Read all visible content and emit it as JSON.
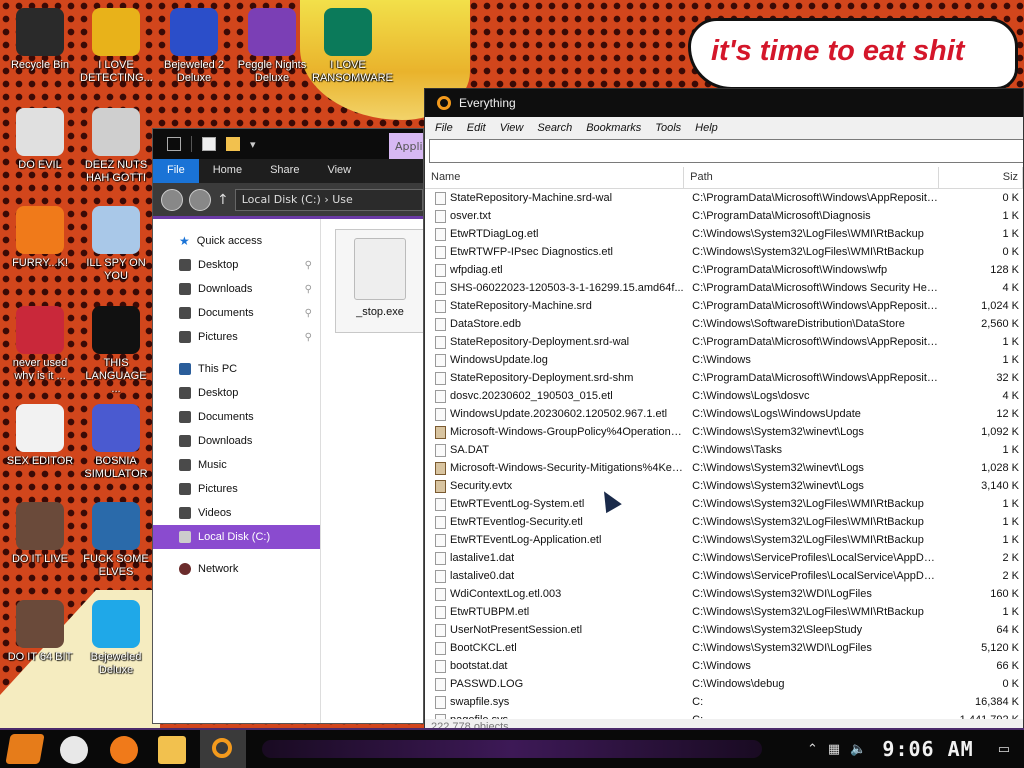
{
  "wallpaper": {
    "speech_text": "it's time to eat shit"
  },
  "desktop": {
    "icons": [
      {
        "label": "Recycle Bin",
        "icon": "recycle-bin-icon",
        "color": "#2a2a2a"
      },
      {
        "label": "I LOVE DETECTING...",
        "icon": "detect-it-easy-icon",
        "color": "#e8b21a"
      },
      {
        "label": "Bejeweled 2 Deluxe",
        "icon": "bejeweled-2-icon",
        "color": "#2b4ec9"
      },
      {
        "label": "Peggle Nights Deluxe",
        "icon": "peggle-nights-icon",
        "color": "#7b3fb5"
      },
      {
        "label": "I LOVE RANSOMWARE",
        "icon": "publisher-icon",
        "color": "#0b7a5a"
      },
      {
        "label": "DO EVIL",
        "icon": "chrome-icon",
        "color": "#e0e0e0"
      },
      {
        "label": "DEEZ NUTS HAH GOTTI",
        "icon": "stacked-windows-icon",
        "color": "#cfcfcf"
      },
      {
        "label": "FURRY...K!",
        "icon": "firefox-icon",
        "color": "#f07a1a"
      },
      {
        "label": "ILL SPY ON YOU",
        "icon": "spy-camera-icon",
        "color": "#a9c8e8"
      },
      {
        "label": "never used why is it ...",
        "icon": "character-app-icon",
        "color": "#c9283a"
      },
      {
        "label": "THIS LANGUAGE ...",
        "icon": "goland-icon",
        "color": "#111111"
      },
      {
        "label": "SEX EDITOR",
        "icon": "hxd-icon",
        "color": "#f2f2f2"
      },
      {
        "label": "BOSNIA SIMULATOR",
        "icon": "mine-icon",
        "color": "#4a5ad0"
      },
      {
        "label": "DO IT LIVE",
        "icon": "portrait-icon",
        "color": "#6a4a3a"
      },
      {
        "label": "FUCK SOME ELVES",
        "icon": "santa-icon",
        "color": "#2a6aaa"
      },
      {
        "label": "DO IT 64 BIT",
        "icon": "portrait-64-icon",
        "color": "#6a4a3a"
      },
      {
        "label": "Bejeweled Deluxe",
        "icon": "diamond-icon",
        "color": "#1fa8e8"
      }
    ]
  },
  "explorer": {
    "app_tab": "Appli",
    "ribbon_tabs": [
      "File",
      "Home",
      "Share",
      "View"
    ],
    "address": "Local Disk (C:)  ›  Use",
    "nav": {
      "quick_access": "Quick access",
      "quick_items": [
        "Desktop",
        "Downloads",
        "Documents",
        "Pictures"
      ],
      "this_pc": "This PC",
      "pc_items": [
        "Desktop",
        "Documents",
        "Downloads",
        "Music",
        "Pictures",
        "Videos"
      ],
      "selected": "Local Disk (C:)",
      "network": "Network"
    },
    "file_name": "_stop.exe"
  },
  "everything": {
    "title": "Everything",
    "menu": [
      "File",
      "Edit",
      "View",
      "Search",
      "Bookmarks",
      "Tools",
      "Help"
    ],
    "search_value": "",
    "columns": {
      "name": "Name",
      "path": "Path",
      "size": "Siz"
    },
    "rows": [
      {
        "name": "StateRepository-Machine.srd-wal",
        "path": "C:\\ProgramData\\Microsoft\\Windows\\AppRepository",
        "size": "0 K",
        "icon": "file"
      },
      {
        "name": "osver.txt",
        "path": "C:\\ProgramData\\Microsoft\\Diagnosis",
        "size": "1 K",
        "icon": "file"
      },
      {
        "name": "EtwRTDiagLog.etl",
        "path": "C:\\Windows\\System32\\LogFiles\\WMI\\RtBackup",
        "size": "1 K",
        "icon": "file"
      },
      {
        "name": "EtwRTWFP-IPsec Diagnostics.etl",
        "path": "C:\\Windows\\System32\\LogFiles\\WMI\\RtBackup",
        "size": "0 K",
        "icon": "file"
      },
      {
        "name": "wfpdiag.etl",
        "path": "C:\\ProgramData\\Microsoft\\Windows\\wfp",
        "size": "128 K",
        "icon": "file"
      },
      {
        "name": "SHS-06022023-120503-3-1-16299.15.amd64f...",
        "path": "C:\\ProgramData\\Microsoft\\Windows Security Heal...",
        "size": "4 K",
        "icon": "file"
      },
      {
        "name": "StateRepository-Machine.srd",
        "path": "C:\\ProgramData\\Microsoft\\Windows\\AppRepository",
        "size": "1,024 K",
        "icon": "file"
      },
      {
        "name": "DataStore.edb",
        "path": "C:\\Windows\\SoftwareDistribution\\DataStore",
        "size": "2,560 K",
        "icon": "file"
      },
      {
        "name": "StateRepository-Deployment.srd-wal",
        "path": "C:\\ProgramData\\Microsoft\\Windows\\AppRepository",
        "size": "1 K",
        "icon": "file"
      },
      {
        "name": "WindowsUpdate.log",
        "path": "C:\\Windows",
        "size": "1 K",
        "icon": "file"
      },
      {
        "name": "StateRepository-Deployment.srd-shm",
        "path": "C:\\ProgramData\\Microsoft\\Windows\\AppRepository",
        "size": "32 K",
        "icon": "file"
      },
      {
        "name": "dosvc.20230602_190503_015.etl",
        "path": "C:\\Windows\\Logs\\dosvc",
        "size": "4 K",
        "icon": "file"
      },
      {
        "name": "WindowsUpdate.20230602.120502.967.1.etl",
        "path": "C:\\Windows\\Logs\\WindowsUpdate",
        "size": "12 K",
        "icon": "file"
      },
      {
        "name": "Microsoft-Windows-GroupPolicy%4Operational...",
        "path": "C:\\Windows\\System32\\winevt\\Logs",
        "size": "1,092 K",
        "icon": "evt"
      },
      {
        "name": "SA.DAT",
        "path": "C:\\Windows\\Tasks",
        "size": "1 K",
        "icon": "file"
      },
      {
        "name": "Microsoft-Windows-Security-Mitigations%4Kern...",
        "path": "C:\\Windows\\System32\\winevt\\Logs",
        "size": "1,028 K",
        "icon": "evt"
      },
      {
        "name": "Security.evtx",
        "path": "C:\\Windows\\System32\\winevt\\Logs",
        "size": "3,140 K",
        "icon": "evt"
      },
      {
        "name": "EtwRTEventLog-System.etl",
        "path": "C:\\Windows\\System32\\LogFiles\\WMI\\RtBackup",
        "size": "1 K",
        "icon": "file"
      },
      {
        "name": "EtwRTEventlog-Security.etl",
        "path": "C:\\Windows\\System32\\LogFiles\\WMI\\RtBackup",
        "size": "1 K",
        "icon": "file"
      },
      {
        "name": "EtwRTEventLog-Application.etl",
        "path": "C:\\Windows\\System32\\LogFiles\\WMI\\RtBackup",
        "size": "1 K",
        "icon": "file"
      },
      {
        "name": "lastalive1.dat",
        "path": "C:\\Windows\\ServiceProfiles\\LocalService\\AppDat...",
        "size": "2 K",
        "icon": "file"
      },
      {
        "name": "lastalive0.dat",
        "path": "C:\\Windows\\ServiceProfiles\\LocalService\\AppDat...",
        "size": "2 K",
        "icon": "file"
      },
      {
        "name": "WdiContextLog.etl.003",
        "path": "C:\\Windows\\System32\\WDI\\LogFiles",
        "size": "160 K",
        "icon": "file"
      },
      {
        "name": "EtwRTUBPM.etl",
        "path": "C:\\Windows\\System32\\LogFiles\\WMI\\RtBackup",
        "size": "1 K",
        "icon": "file"
      },
      {
        "name": "UserNotPresentSession.etl",
        "path": "C:\\Windows\\System32\\SleepStudy",
        "size": "64 K",
        "icon": "file"
      },
      {
        "name": "BootCKCL.etl",
        "path": "C:\\Windows\\System32\\WDI\\LogFiles",
        "size": "5,120 K",
        "icon": "file"
      },
      {
        "name": "bootstat.dat",
        "path": "C:\\Windows",
        "size": "66 K",
        "icon": "file"
      },
      {
        "name": "PASSWD.LOG",
        "path": "C:\\Windows\\debug",
        "size": "0 K",
        "icon": "file"
      },
      {
        "name": "swapfile.sys",
        "path": "C:",
        "size": "16,384 K",
        "icon": "file"
      },
      {
        "name": "pagefile.sys",
        "path": "C:",
        "size": "1,441,792 K",
        "icon": "file"
      }
    ],
    "status": "222,778 objects"
  },
  "taskbar": {
    "apps": [
      {
        "icon": "chrome-icon",
        "color": "#e8e8e8"
      },
      {
        "icon": "firefox-icon",
        "color": "#f07a1a"
      },
      {
        "icon": "file-explorer-icon",
        "color": "#f2c14e"
      }
    ],
    "clock": "9:06 AM"
  }
}
